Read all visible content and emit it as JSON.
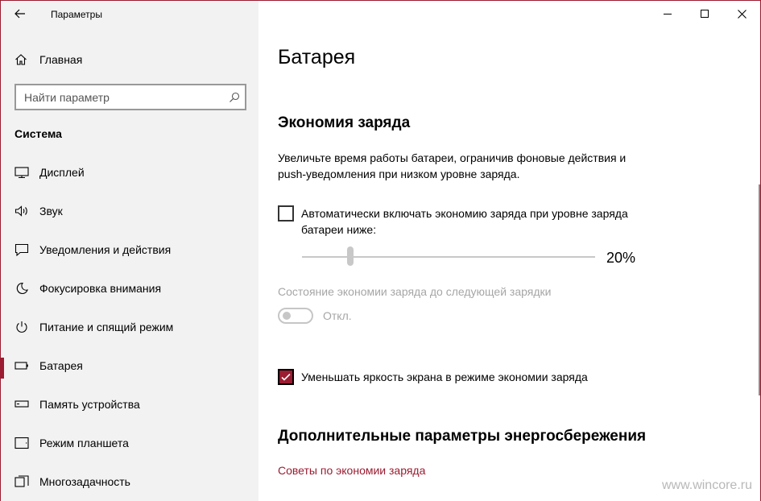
{
  "window": {
    "title": "Параметры",
    "controls": {
      "minimize": "minimize-icon",
      "maximize": "maximize-icon",
      "close": "close-icon"
    }
  },
  "sidebar": {
    "home_label": "Главная",
    "search_placeholder": "Найти параметр",
    "section_title": "Система",
    "items": [
      {
        "label": "Дисплей",
        "icon": "display-icon"
      },
      {
        "label": "Звук",
        "icon": "sound-icon"
      },
      {
        "label": "Уведомления и действия",
        "icon": "notifications-icon"
      },
      {
        "label": "Фокусировка внимания",
        "icon": "moon-icon"
      },
      {
        "label": "Питание и спящий режим",
        "icon": "power-icon"
      },
      {
        "label": "Батарея",
        "icon": "battery-icon",
        "active": true
      },
      {
        "label": "Память устройства",
        "icon": "storage-icon"
      },
      {
        "label": "Режим планшета",
        "icon": "tablet-icon"
      },
      {
        "label": "Многозадачность",
        "icon": "multitasking-icon"
      }
    ]
  },
  "main": {
    "page_title": "Батарея",
    "saver_heading": "Экономия заряда",
    "saver_description": "Увеличьте время работы батареи, ограничив фоновые действия и push-уведомления при низком уровне заряда.",
    "auto_checkbox": {
      "label": "Автоматически включать экономию заряда при уровне заряда батареи ниже:",
      "checked": false
    },
    "threshold": {
      "value_label": "20%",
      "value": 0.2
    },
    "status_label": "Состояние экономии заряда до следующей зарядки",
    "toggle": {
      "state_label": "Откл.",
      "on": false
    },
    "brightness_checkbox": {
      "label": "Уменьшать яркость экрана в режиме экономии заряда",
      "checked": true
    },
    "more_heading": "Дополнительные параметры энергосбережения",
    "links": [
      "Советы по экономии заряда"
    ]
  },
  "watermark": "www.wincore.ru",
  "colors": {
    "accent": "#9b1b30",
    "sidebar_bg": "#f2f2f2",
    "disabled": "#a6a6a6"
  }
}
